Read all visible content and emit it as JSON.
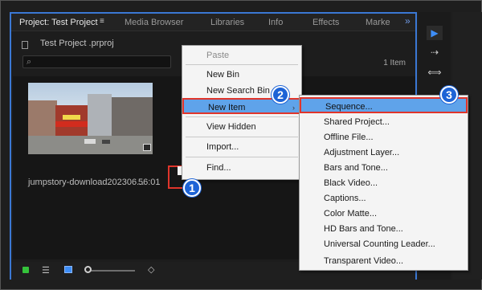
{
  "tabs": {
    "project": "Project: Test Project",
    "menu_icon": "≡",
    "media_browser": "Media Browser",
    "libraries": "Libraries",
    "info": "Info",
    "effects": "Effects",
    "markers": "Marke",
    "overflow": "»"
  },
  "project": {
    "filename": "Test Project .prproj",
    "search_icon": "⌕",
    "item_count": "1 Item"
  },
  "clip": {
    "name": "jumpstory-download202306...",
    "duration": "56:01"
  },
  "bottom_bar": {
    "list_view_icon": "☰",
    "sort_icon": "◇"
  },
  "tools": {
    "select": "▶",
    "track": "⇢",
    "ripple": "⟺"
  },
  "context_menu": {
    "items": [
      {
        "label": "Paste",
        "disabled": true
      },
      {
        "label": "New Bin"
      },
      {
        "label": "New Search Bin"
      },
      {
        "label": "New Item",
        "highlighted": true,
        "arrow": "›"
      },
      {
        "label": "View Hidden"
      },
      {
        "label": "Import..."
      },
      {
        "label": "Find..."
      }
    ]
  },
  "submenu": {
    "items": [
      {
        "label": "Sequence...",
        "highlighted": true
      },
      {
        "label": "Shared Project..."
      },
      {
        "label": "Offline File..."
      },
      {
        "label": "Adjustment Layer..."
      },
      {
        "label": "Bars and Tone..."
      },
      {
        "label": "Black Video..."
      },
      {
        "label": "Captions..."
      },
      {
        "label": "Color Matte..."
      },
      {
        "label": "HD Bars and Tone..."
      },
      {
        "label": "Universal Counting Leader..."
      },
      {
        "label": "Transparent Video..."
      }
    ]
  },
  "callouts": {
    "one": "1",
    "two": "2",
    "three": "3"
  },
  "colors": {
    "accent_blue": "#3b78d4",
    "highlight": "#5fa3ea",
    "callout_border": "#e0352b"
  }
}
